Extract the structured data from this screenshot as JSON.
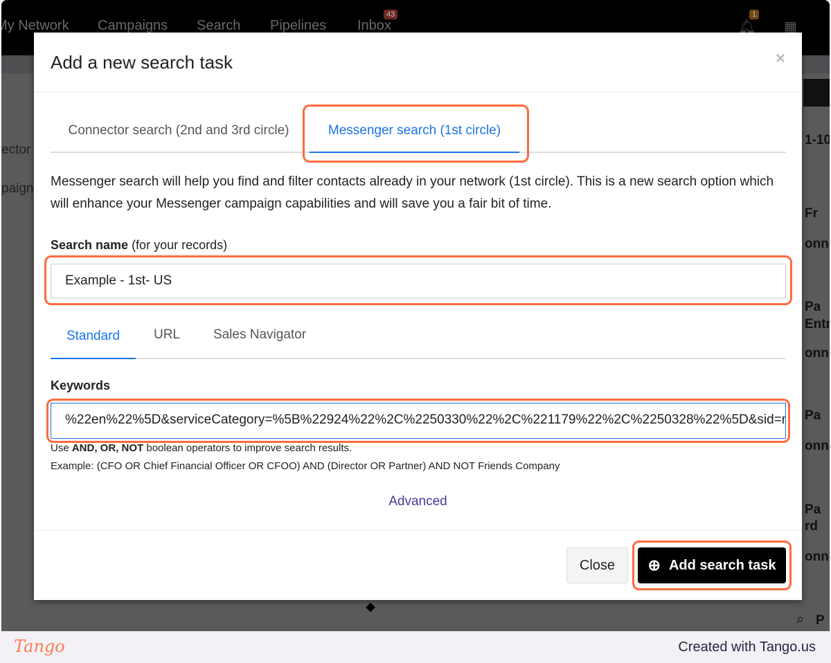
{
  "background": {
    "nav": [
      "My Network",
      "Campaigns",
      "Search",
      "Pipelines",
      "Inbox"
    ],
    "inbox_badge": "43",
    "notif_badge": "1",
    "left_items": [
      "ector",
      "paign"
    ],
    "right_items": [
      "1-10",
      "Fr",
      "onne",
      "Pa",
      "Entre",
      "onne",
      "Pa",
      "onne",
      "Pa",
      "rd",
      "onne",
      "P"
    ]
  },
  "modal": {
    "title": "Add a new search task",
    "close_x": "×",
    "tabs": [
      {
        "label": "Connector search (2nd and 3rd circle)",
        "active": false
      },
      {
        "label": "Messenger search (1st circle)",
        "active": true
      }
    ],
    "description": "Messenger search will help you find and filter contacts already in your network (1st circle). This is a new search option which will enhance your Messenger campaign capabilities and will save you a fair bit of time.",
    "search_name_label": "Search name",
    "search_name_hint": " (for your records)",
    "search_name_value": "Example - 1st- US",
    "subtabs": [
      {
        "label": "Standard",
        "active": true
      },
      {
        "label": "URL",
        "active": false
      },
      {
        "label": "Sales Navigator",
        "active": false
      }
    ],
    "keywords_label": "Keywords",
    "keywords_value": "%22en%22%5D&serviceCategory=%5B%22924%22%2C%2250330%22%2C%221179%22%2C%2250328%22%5D&sid=nOr",
    "help_pre": "Use ",
    "help_bold": "AND, OR, NOT",
    "help_post": " boolean operators to improve search results.",
    "example": "Example: (CFO OR Chief Financial Officer OR CFOO) AND (Director OR Partner) AND NOT Friends Company",
    "advanced": "Advanced",
    "close_button": "Close",
    "add_button": "Add search task"
  },
  "tango": {
    "logo": "Tango",
    "credit": "Created with Tango.us"
  },
  "colors": {
    "accent": "#1a73e8",
    "highlight": "#ff6a3d",
    "primary_button": "#000000"
  }
}
